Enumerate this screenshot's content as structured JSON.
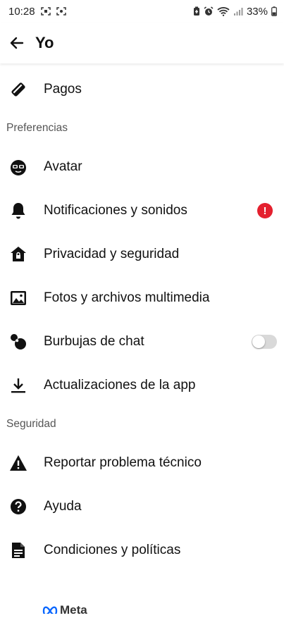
{
  "status_bar": {
    "time": "10:28",
    "battery": "33%"
  },
  "header": {
    "title": "Yo"
  },
  "top_items": [
    {
      "label": "Pagos",
      "icon": "payment-tag-icon"
    }
  ],
  "sections": [
    {
      "title": "Preferencias",
      "items": [
        {
          "label": "Avatar",
          "icon": "avatar-icon"
        },
        {
          "label": "Notificaciones y sonidos",
          "icon": "bell-icon",
          "badge": "!"
        },
        {
          "label": "Privacidad y seguridad",
          "icon": "home-lock-icon"
        },
        {
          "label": "Fotos y archivos multimedia",
          "icon": "photo-icon"
        },
        {
          "label": "Burbujas de chat",
          "icon": "chat-bubbles-icon",
          "toggle_on": false
        },
        {
          "label": "Actualizaciones de la app",
          "icon": "download-icon"
        }
      ]
    },
    {
      "title": "Seguridad",
      "items": [
        {
          "label": "Reportar problema técnico",
          "icon": "warning-icon"
        },
        {
          "label": "Ayuda",
          "icon": "help-icon"
        },
        {
          "label": "Condiciones y políticas",
          "icon": "document-icon"
        }
      ]
    }
  ],
  "footer": {
    "brand": "Meta"
  },
  "colors": {
    "badge": "#e4202e",
    "toggle_off": "#d9d9d9",
    "section_header": "#555555"
  }
}
